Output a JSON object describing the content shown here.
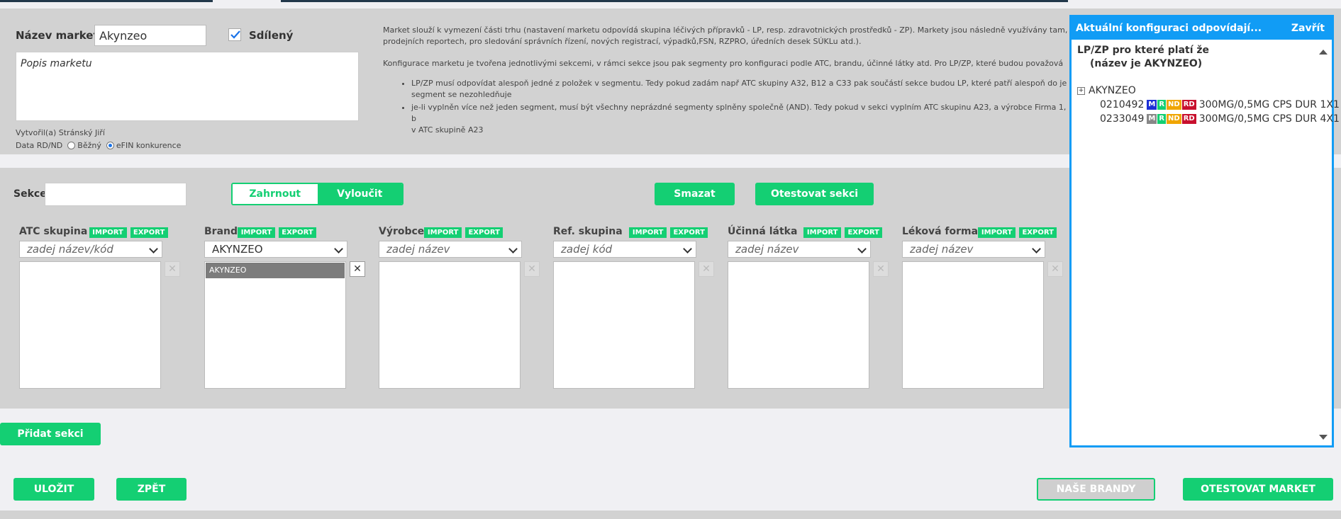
{
  "market": {
    "name_label": "Název marketu",
    "name_value": "Akynzeo",
    "shared_label": "Sdílený",
    "shared_checked": true,
    "description_placeholder": "Popis marketu",
    "created_by": "Vytvořil(a) Stránský Jiří",
    "data_label": "Data RD/ND",
    "radio_normal": "Běžný",
    "radio_efin": "eFIN konkurence",
    "selected_radio": "eFIN konkurence"
  },
  "info": {
    "p1": "Market slouží k vymezení části trhu (nastavení marketu odpovídá skupina léčivých přípravků - LP, resp. zdravotnických prostředků - ZP). Markety jsou následně využívány tam,",
    "p1b": "prodejních reportech, pro sledování správních řízení, nových registrací, výpadků,FSN, RZPRO, úředních desek SÚKLu atd.).",
    "p2": "Konfigurace marketu je tvořena jednotlivými sekcemi, v rámci sekce jsou pak segmenty pro konfiguraci podle ATC, brandu, účinné látky atd. Pro LP/ZP, které budou považová",
    "li1a": "LP/ZP musí odpovídat alespoň jedné z položek v segmentu. Tedy pokud zadám např ATC skupiny A32, B12 a C33 pak součástí sekce budou LP, které patří alespoň do je",
    "li1b": "segment se nezohledňuje",
    "li2a": "je-li vyplněn více než jeden segment, musí být všechny neprázdné segmenty splněny společně (AND). Tedy pokud v sekci vyplním ATC skupinu A23, a výrobce Firma 1, b",
    "li2b": "v ATC skupině A23"
  },
  "section": {
    "label": "Sekce",
    "include": "Zahrnout",
    "exclude": "Vyloučit",
    "delete": "Smazat",
    "test_section": "Otestovat sekci",
    "import": "IMPORT",
    "export": "EXPORT",
    "columns": [
      {
        "title": "ATC skupina",
        "placeholder": "zadej název/kód",
        "items": []
      },
      {
        "title": "Brand",
        "placeholder": "AKYNZEO",
        "items": [
          "AKYNZEO"
        ]
      },
      {
        "title": "Výrobce",
        "placeholder": "zadej název",
        "items": []
      },
      {
        "title": "Ref. skupina",
        "placeholder": "zadej kód",
        "items": []
      },
      {
        "title": "Účinná látka",
        "placeholder": "zadej název",
        "items": []
      },
      {
        "title": "Léková forma",
        "placeholder": "zadej název",
        "items": []
      }
    ],
    "add_section": "Přidat sekci"
  },
  "panel": {
    "title": "Aktuální konfiguraci odpovídají...",
    "close": "Zavřít",
    "heading": "LP/ZP pro které platí že",
    "subheading": "(název je AKYNZEO)",
    "tree_root": "AKYNZEO",
    "plus": "⊞",
    "products": [
      {
        "code": "0210492",
        "desc": "300MG/0,5MG CPS DUR 1X1",
        "badges": [
          "M",
          "R",
          "ND",
          "RD"
        ]
      },
      {
        "code": "0233049",
        "desc": "300MG/0,5MG CPS DUR 4X1",
        "badges": [
          "M",
          "R",
          "ND",
          "RD"
        ]
      }
    ],
    "badge_colors_row1": [
      "#1c2fd6",
      "#14cf73",
      "#f0a500",
      "#c8102e"
    ],
    "badge_colors_row2": [
      "#888888",
      "#14cf73",
      "#f0a500",
      "#c8102e"
    ]
  },
  "footer": {
    "save": "ULOŽIT",
    "back": "ZPĚT",
    "our_brands": "NAŠE BRANDY",
    "test_market": "OTESTOVAT MARKET"
  },
  "colors": {
    "green": "#14cf73",
    "blue": "#119cf5",
    "panel_grey": "#d2d2d2"
  }
}
